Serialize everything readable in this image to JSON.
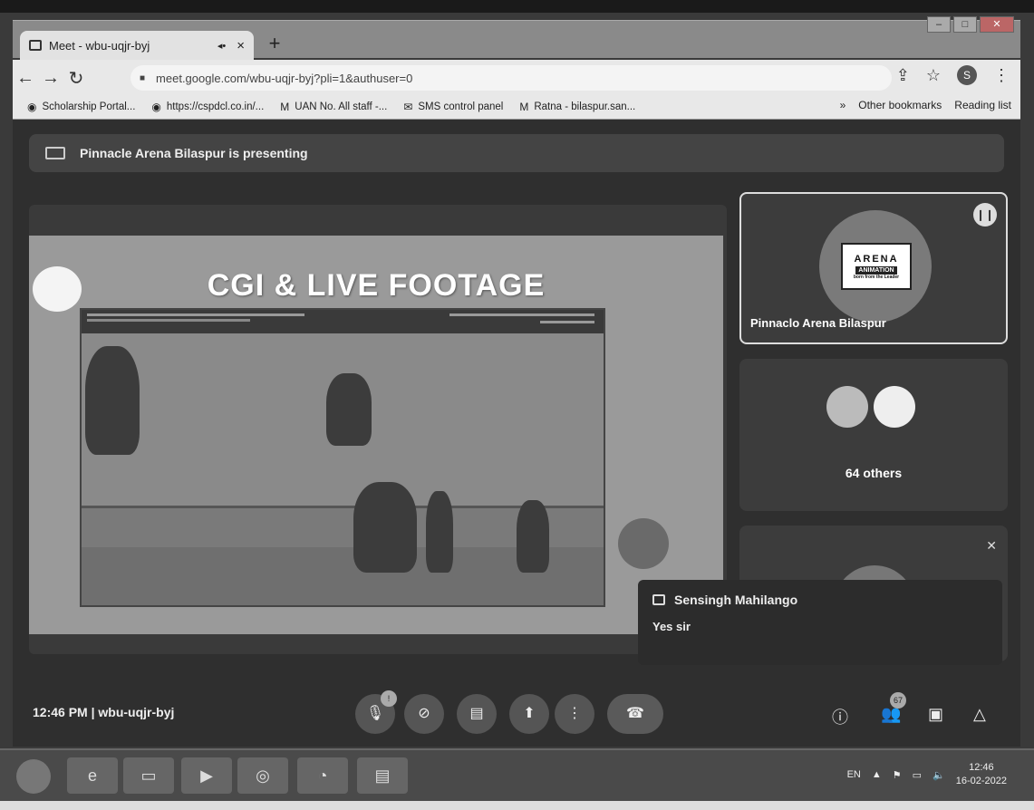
{
  "browser": {
    "tab_title": "Meet - wbu-uqjr-byj",
    "tab_close": "×",
    "new_tab": "+",
    "url": "meet.google.com/wbu-uqjr-byj?pli=1&authuser=0",
    "profile_initial": "S",
    "bookmarks": [
      {
        "icon": "globe-icon",
        "label": "Scholarship Portal..."
      },
      {
        "icon": "globe-icon",
        "label": "https://cspdcl.co.in/..."
      },
      {
        "icon": "gmail-icon",
        "label": "UAN No. All staff -..."
      },
      {
        "icon": "mail-icon",
        "label": "SMS control panel"
      },
      {
        "icon": "gmail-icon",
        "label": "Ratna - bilaspur.san..."
      }
    ],
    "bookmarks_overflow": "»",
    "other_bookmarks": "Other bookmarks",
    "reading_list": "Reading list"
  },
  "meet": {
    "presenting_banner": "Pinnacle Arena Bilaspur is presenting",
    "slide_title": "CGI & LIVE FOOTAGE",
    "tiles": {
      "presenter_name": "Pinnaclo Arena Bilaspur",
      "logo_text": "ARENA",
      "logo_sub": "ANIMATION",
      "logo_tag": "born from the Leader",
      "others_label": "64 others"
    },
    "chat_toast": {
      "sender": "Sensingh Mahilango",
      "message": "Yes sir"
    },
    "meeting_info": "12:46 PM  |  wbu-uqjr-byj",
    "participant_count": "67",
    "mic_badge": "!"
  },
  "taskbar": {
    "lang": "EN",
    "time": "12:46",
    "date": "16-02-2022"
  }
}
